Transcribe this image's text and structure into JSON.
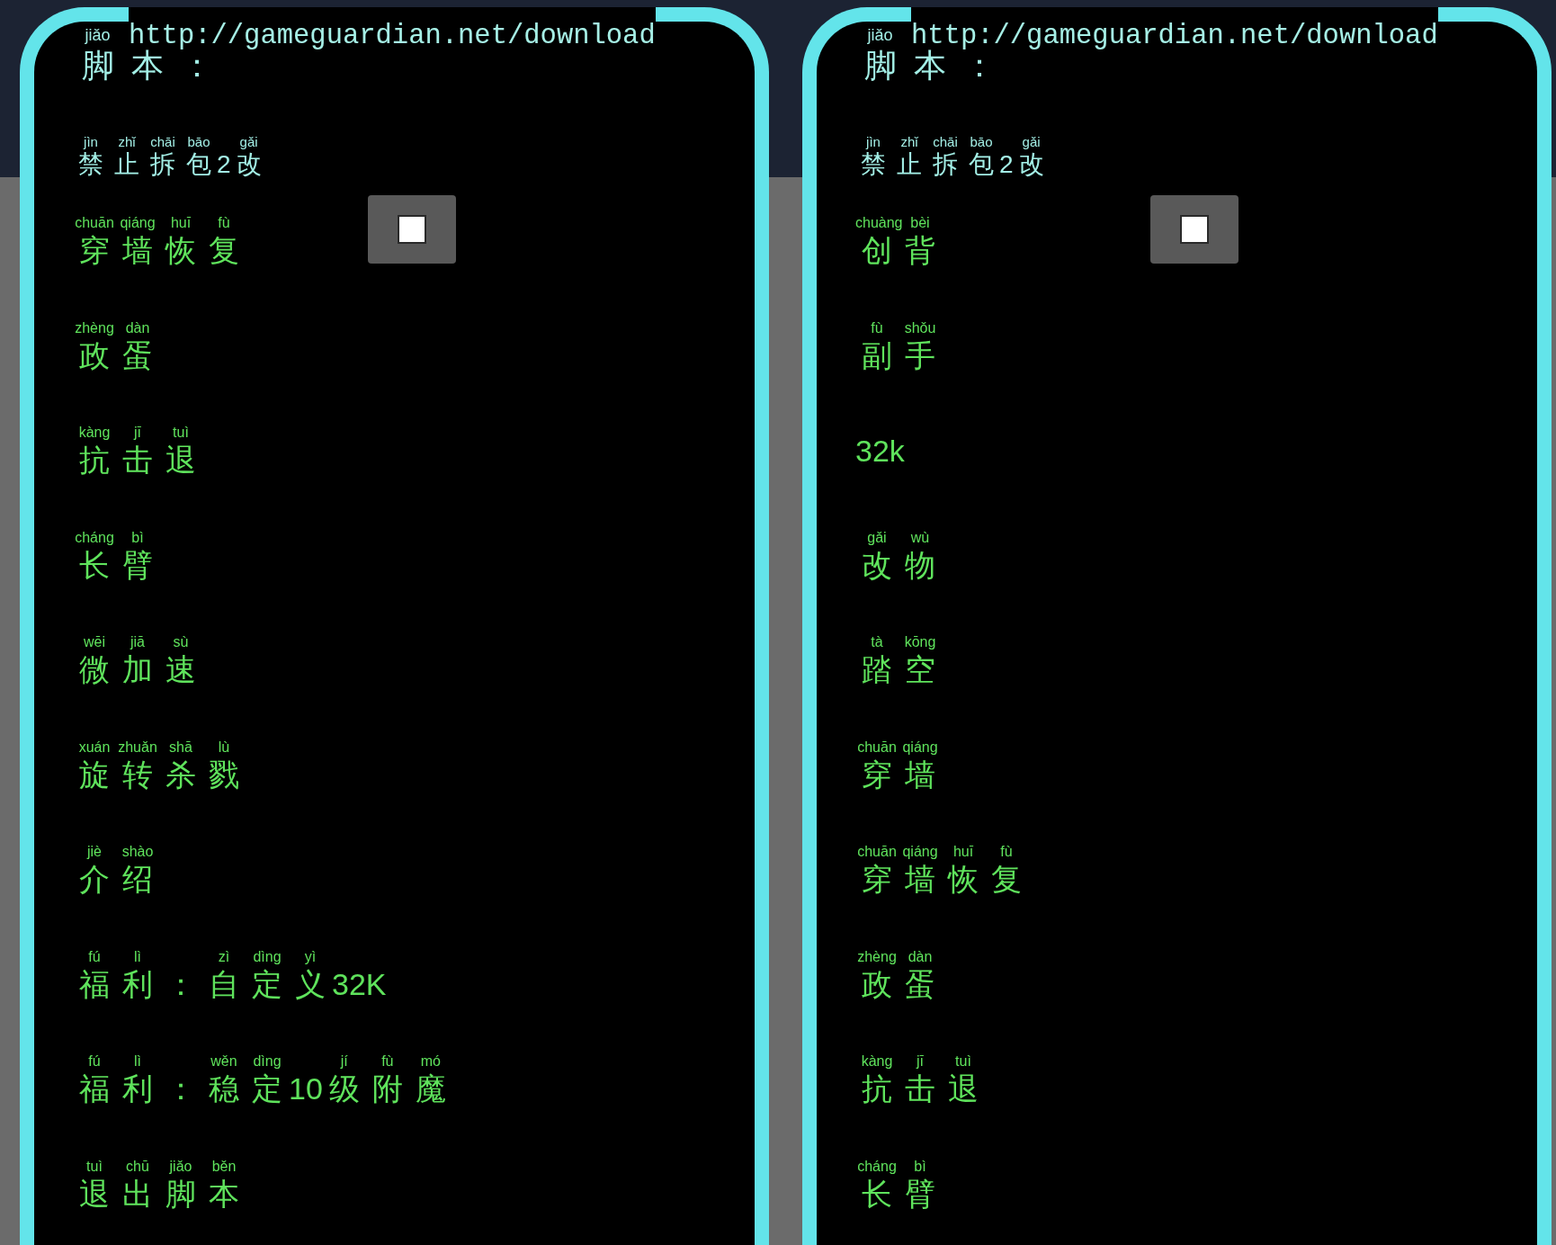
{
  "panels": [
    {
      "header": {
        "pinyin": "jiǎo",
        "url": "http://gameguardian.net/download",
        "label": "脚本："
      },
      "title": {
        "pinyin": "jìn zhǐ chāi bāo gǎi",
        "label": "禁止拆包2改"
      },
      "items": [
        {
          "pinyin": "chuān qiáng huī fù",
          "label": "穿墙恢复"
        },
        {
          "pinyin": "zhèng dàn",
          "label": "政蛋"
        },
        {
          "pinyin": "kàng jī tuì",
          "label": "抗击退"
        },
        {
          "pinyin": "cháng bì",
          "label": "长臂"
        },
        {
          "pinyin": "wēi jiā sù",
          "label": "微加速"
        },
        {
          "pinyin": "xuán zhuǎn shā lù",
          "label": "旋转杀戮"
        },
        {
          "pinyin": "jiè shào",
          "label": "介绍"
        },
        {
          "pinyin": "fú lì zì dìng yì",
          "label": "福利：自定义32K"
        },
        {
          "pinyin": "fú lì wěn dìng jí fù mó",
          "label": "福利：稳定10级附魔"
        },
        {
          "pinyin": "tuì chū jiǎo běn",
          "label": "退出脚本"
        }
      ]
    },
    {
      "header": {
        "pinyin": "jiǎo",
        "url": "http://gameguardian.net/download",
        "label": "脚本："
      },
      "title": {
        "pinyin": "jìn zhǐ chāi bāo gǎi",
        "label": "禁止拆包2改"
      },
      "items": [
        {
          "pinyin": "chuàng bèi",
          "label": "创背"
        },
        {
          "pinyin": "fù shǒu",
          "label": "副手"
        },
        {
          "label": "32k"
        },
        {
          "pinyin": "gǎi wù",
          "label": "改物"
        },
        {
          "pinyin": "tà kōng",
          "label": "踏空"
        },
        {
          "pinyin": "chuān qiáng",
          "label": "穿墙"
        },
        {
          "pinyin": "chuān qiáng huī fù",
          "label": "穿墙恢复"
        },
        {
          "pinyin": "zhèng dàn",
          "label": "政蛋"
        },
        {
          "pinyin": "kàng jī tuì",
          "label": "抗击退"
        },
        {
          "pinyin": "cháng bì",
          "label": "长臂"
        }
      ]
    }
  ]
}
